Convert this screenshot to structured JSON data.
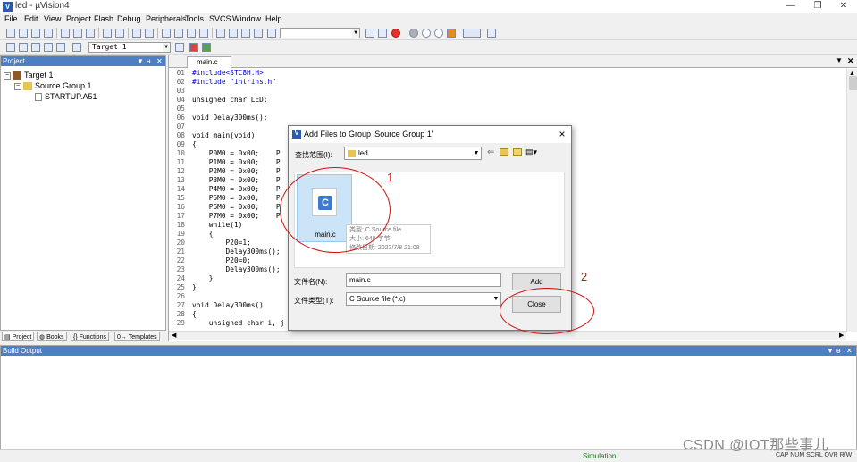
{
  "window": {
    "title": "led - µVision4"
  },
  "menu": [
    "File",
    "Edit",
    "View",
    "Project",
    "Flash",
    "Debug",
    "Peripherals",
    "Tools",
    "SVCS",
    "Window",
    "Help"
  ],
  "toolbar2": {
    "target": "Target 1"
  },
  "project_panel": {
    "title": "Project",
    "tree": {
      "target": "Target 1",
      "group": "Source Group 1",
      "file": "STARTUP.A51"
    },
    "tabs": [
      "Project",
      "Books",
      "Functions",
      "Templates"
    ]
  },
  "editor": {
    "tab": "main.c",
    "lines": [
      {
        "n": "01",
        "t": "#include<STC8H.H>"
      },
      {
        "n": "02",
        "t": "#include \"intrins.h\""
      },
      {
        "n": "03",
        "t": ""
      },
      {
        "n": "04",
        "t": "unsigned char LED;"
      },
      {
        "n": "05",
        "t": ""
      },
      {
        "n": "06",
        "t": "void Delay300ms();"
      },
      {
        "n": "07",
        "t": ""
      },
      {
        "n": "08",
        "t": "void main(void)"
      },
      {
        "n": "09",
        "t": "{"
      },
      {
        "n": "10",
        "t": "    P0M0 = 0x00;    P"
      },
      {
        "n": "11",
        "t": "    P1M0 = 0x00;    P"
      },
      {
        "n": "12",
        "t": "    P2M0 = 0x00;    P"
      },
      {
        "n": "13",
        "t": "    P3M0 = 0x00;    P"
      },
      {
        "n": "14",
        "t": "    P4M0 = 0x00;    P"
      },
      {
        "n": "15",
        "t": "    P5M0 = 0x00;    P"
      },
      {
        "n": "16",
        "t": "    P6M0 = 0x00;    P"
      },
      {
        "n": "17",
        "t": "    P7M0 = 0x00;    P"
      },
      {
        "n": "18",
        "t": "    while(1)"
      },
      {
        "n": "19",
        "t": "    {"
      },
      {
        "n": "20",
        "t": "        P20=1;"
      },
      {
        "n": "21",
        "t": "        Delay300ms();"
      },
      {
        "n": "22",
        "t": "        P20=0;"
      },
      {
        "n": "23",
        "t": "        Delay300ms();"
      },
      {
        "n": "24",
        "t": "    }"
      },
      {
        "n": "25",
        "t": "}"
      },
      {
        "n": "26",
        "t": ""
      },
      {
        "n": "27",
        "t": "void Delay300ms()"
      },
      {
        "n": "28",
        "t": "{"
      },
      {
        "n": "29",
        "t": "    unsigned char i, j"
      }
    ]
  },
  "dialog": {
    "title": "Add Files to Group 'Source Group 1'",
    "lookin_label": "查找范围(I):",
    "lookin_value": "led",
    "file": {
      "name": "main.c",
      "icon": "C"
    },
    "tooltip": [
      "类型: C Source file",
      "大小: 648 字节",
      "修改日期: 2023/7/8 21:08"
    ],
    "filename_label": "文件名(N):",
    "filename_value": "main.c",
    "filetype_label": "文件类型(T):",
    "filetype_value": "C Source file (*.c)",
    "add_button": "Add",
    "close_button": "Close"
  },
  "annotations": {
    "one": "1",
    "two": "2"
  },
  "build_output": {
    "title": "Build Output"
  },
  "status": {
    "simulation": "Simulation",
    "keys": "CAP NUM SCRL OVR R/W"
  },
  "watermark": "CSDN @IOT那些事儿",
  "colors": {
    "panel_header": "#4d7fc4",
    "annotation_red": "#d01010",
    "selection": "#cce4f7"
  }
}
